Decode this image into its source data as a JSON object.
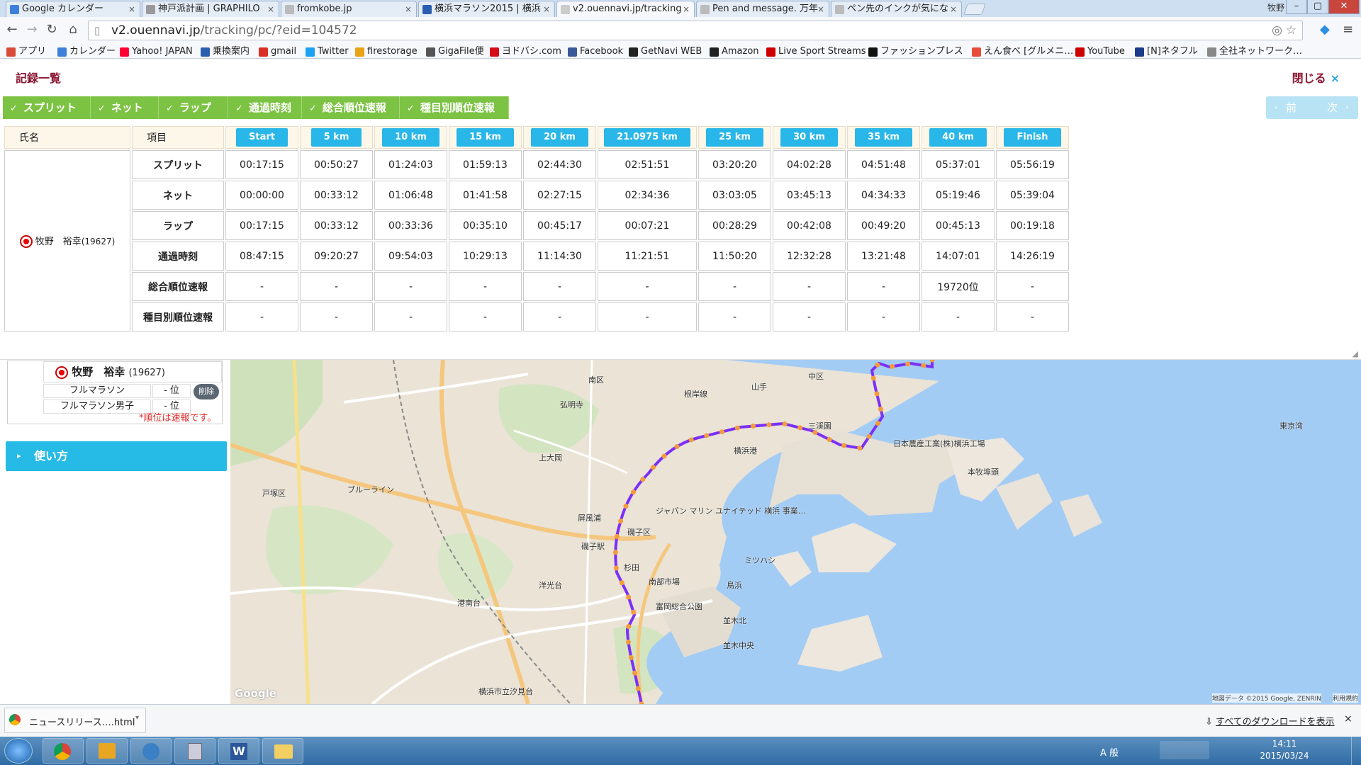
{
  "browser": {
    "tabs": [
      {
        "title": "Google カレンダー",
        "fav_color": "#3f7fdc"
      },
      {
        "title": "神戸派計画 | GRAPHILO",
        "fav_color": "#999999"
      },
      {
        "title": "fromkobe.jp",
        "fav_color": "#bbbbbb"
      },
      {
        "title": "横浜マラソン2015 | 横浜",
        "fav_color": "#2a5fb0"
      },
      {
        "title": "v2.ouennavi.jp/tracking",
        "fav_color": "#cccccc"
      },
      {
        "title": "Pen and message. 万年",
        "fav_color": "#bbbbbb"
      },
      {
        "title": "ペン先のインクが気にな",
        "fav_color": "#bbbbbb"
      }
    ],
    "user_label": "牧野",
    "url_host": "v2.ouennavi.jp",
    "url_path": "/tracking/pc/?eid=104572",
    "bookmarks": [
      {
        "label": "アプリ",
        "color": "#d94a38"
      },
      {
        "label": "カレンダー",
        "color": "#3f7fdc"
      },
      {
        "label": "Yahoo! JAPAN",
        "color": "#ff0033"
      },
      {
        "label": "乗換案内",
        "color": "#2a5fb0"
      },
      {
        "label": "gmail",
        "color": "#d93025"
      },
      {
        "label": "Twitter",
        "color": "#1da1f2"
      },
      {
        "label": "firestorage",
        "color": "#e8a317"
      },
      {
        "label": "GigaFile便",
        "color": "#555555"
      },
      {
        "label": "ヨドバシ.com",
        "color": "#d70c18"
      },
      {
        "label": "Facebook",
        "color": "#3b5998"
      },
      {
        "label": "GetNavi WEB",
        "color": "#222222"
      },
      {
        "label": "Amazon",
        "color": "#222222"
      },
      {
        "label": "Live Sport Streams",
        "color": "#d00000"
      },
      {
        "label": "ファッションプレス",
        "color": "#111111"
      },
      {
        "label": "えん食べ [グルメニ…",
        "color": "#e74c3c"
      },
      {
        "label": "YouTube",
        "color": "#cc0000"
      },
      {
        "label": "[N]ネタフル",
        "color": "#1a3a8a"
      },
      {
        "label": "全社ネットワーク…",
        "color": "#888888"
      }
    ]
  },
  "records": {
    "title": "記録一覧",
    "close_label": "閉じる",
    "close_icon": "×",
    "filter_tabs": [
      "スプリット",
      "ネット",
      "ラップ",
      "通過時刻",
      "総合順位速報",
      "種目別順位速報"
    ],
    "pager": {
      "prev": "前",
      "next": "次"
    },
    "col_name": "氏名",
    "col_item": "項目",
    "checkpoints": [
      "Start",
      "5 km",
      "10 km",
      "15 km",
      "20 km",
      "21.0975 km",
      "25 km",
      "30 km",
      "35 km",
      "40 km",
      "Finish"
    ],
    "runner": {
      "name": "牧野　裕幸",
      "bib": "(19627)"
    },
    "rows": [
      {
        "label": "スプリット",
        "values": [
          "00:17:15",
          "00:50:27",
          "01:24:03",
          "01:59:13",
          "02:44:30",
          "02:51:51",
          "03:20:20",
          "04:02:28",
          "04:51:48",
          "05:37:01",
          "05:56:19"
        ]
      },
      {
        "label": "ネット",
        "values": [
          "00:00:00",
          "00:33:12",
          "01:06:48",
          "01:41:58",
          "02:27:15",
          "02:34:36",
          "03:03:05",
          "03:45:13",
          "04:34:33",
          "05:19:46",
          "05:39:04"
        ]
      },
      {
        "label": "ラップ",
        "values": [
          "00:17:15",
          "00:33:12",
          "00:33:36",
          "00:35:10",
          "00:45:17",
          "00:07:21",
          "00:28:29",
          "00:42:08",
          "00:49:20",
          "00:45:13",
          "00:19:18"
        ]
      },
      {
        "label": "通過時刻",
        "values": [
          "08:47:15",
          "09:20:27",
          "09:54:03",
          "10:29:13",
          "11:14:30",
          "11:21:51",
          "11:50:20",
          "12:32:28",
          "13:21:48",
          "14:07:01",
          "14:26:19"
        ]
      },
      {
        "label": "総合順位速報",
        "values": [
          "-",
          "-",
          "-",
          "-",
          "-",
          "-",
          "-",
          "-",
          "-",
          "19720位",
          "-"
        ]
      },
      {
        "label": "種目別順位速報",
        "values": [
          "-",
          "-",
          "-",
          "-",
          "-",
          "-",
          "-",
          "-",
          "-",
          "-",
          "-"
        ]
      }
    ]
  },
  "side": {
    "runner_name": "牧野　裕幸",
    "runner_bib": "(19627)",
    "delete_label": "削除",
    "categories": [
      {
        "label": "フルマラソン",
        "rank": "- 位"
      },
      {
        "label": "フルマラソン男子",
        "rank": "- 位"
      }
    ],
    "note": "*順位は速報です。",
    "howto_label": "使い方"
  },
  "map": {
    "places": [
      "南区",
      "中区",
      "山手",
      "三渓園",
      "本牧埠頭",
      "戸塚区",
      "上大岡",
      "弘明寺",
      "磯子区",
      "屏風浦",
      "杉田",
      "洋光台",
      "港南台",
      "富岡総合公園",
      "鳥浜",
      "並木北",
      "並木中央",
      "南部市場",
      "ミツハシ",
      "ブルーライン",
      "日本農産工業(株)横浜工場",
      "ジャパン マリン ユナイテッド 横浜 事業…",
      "横浜市立汐見台",
      "東京湾",
      "根岸線",
      "横浜港",
      "磯子駅"
    ],
    "attribution": "地図データ ©2015 Google, ZENRIN",
    "terms": "利用規約",
    "google": "Google",
    "route_color": "#7b2ff7",
    "marker_color": "#f39c3c"
  },
  "downloads": {
    "file": "ニュースリリース….html",
    "show_all": "すべてのダウンロードを表示",
    "close_icon": "×"
  },
  "taskbar": {
    "ime": "A 般",
    "time": "14:11",
    "date": "2015/03/24"
  }
}
